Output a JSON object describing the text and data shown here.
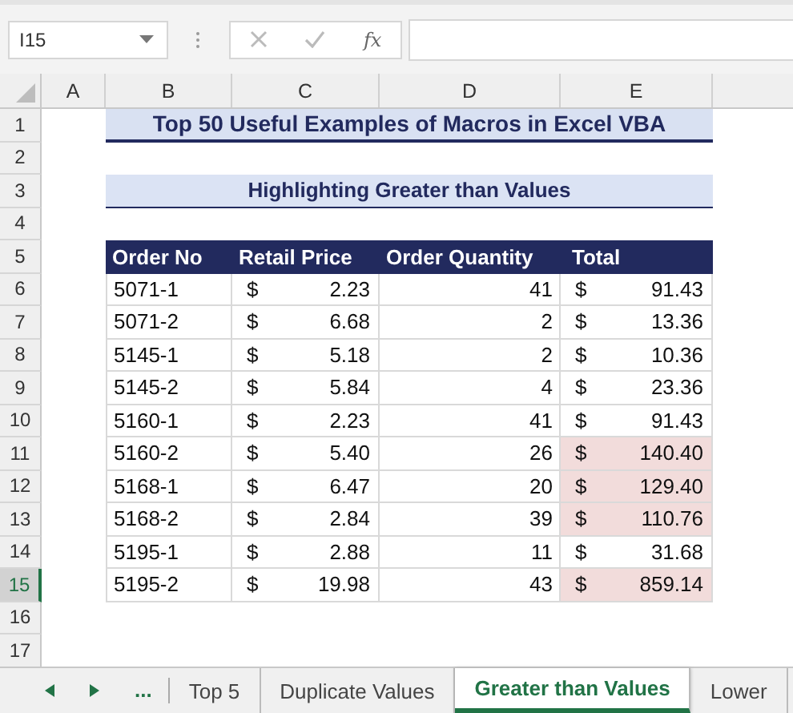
{
  "name_box": "I15",
  "function_label": "fx",
  "column_headers": [
    "A",
    "B",
    "C",
    "D",
    "E"
  ],
  "rows": [
    {
      "number": "1",
      "selected": false,
      "kind": "title",
      "text": "Top 50 Useful Examples of Macros in Excel VBA"
    },
    {
      "number": "2",
      "selected": false,
      "kind": "empty"
    },
    {
      "number": "3",
      "selected": false,
      "kind": "subtitle",
      "text": "Highlighting Greater than Values"
    },
    {
      "number": "4",
      "selected": false,
      "kind": "empty"
    },
    {
      "number": "5",
      "selected": false,
      "kind": "header",
      "cells": [
        "Order No",
        "Retail Price",
        "Order Quantity",
        "Total"
      ]
    },
    {
      "number": "6",
      "selected": false,
      "kind": "data",
      "order_no": "5071-1",
      "price_symbol": "$",
      "price": "2.23",
      "quantity": "41",
      "total_symbol": "$",
      "total": "91.43",
      "highlighted": false
    },
    {
      "number": "7",
      "selected": false,
      "kind": "data",
      "order_no": "5071-2",
      "price_symbol": "$",
      "price": "6.68",
      "quantity": "2",
      "total_symbol": "$",
      "total": "13.36",
      "highlighted": false
    },
    {
      "number": "8",
      "selected": false,
      "kind": "data",
      "order_no": "5145-1",
      "price_symbol": "$",
      "price": "5.18",
      "quantity": "2",
      "total_symbol": "$",
      "total": "10.36",
      "highlighted": false
    },
    {
      "number": "9",
      "selected": false,
      "kind": "data",
      "order_no": "5145-2",
      "price_symbol": "$",
      "price": "5.84",
      "quantity": "4",
      "total_symbol": "$",
      "total": "23.36",
      "highlighted": false
    },
    {
      "number": "10",
      "selected": false,
      "kind": "data",
      "order_no": "5160-1",
      "price_symbol": "$",
      "price": "2.23",
      "quantity": "41",
      "total_symbol": "$",
      "total": "91.43",
      "highlighted": false
    },
    {
      "number": "11",
      "selected": false,
      "kind": "data",
      "order_no": "5160-2",
      "price_symbol": "$",
      "price": "5.40",
      "quantity": "26",
      "total_symbol": "$",
      "total": "140.40",
      "highlighted": true
    },
    {
      "number": "12",
      "selected": false,
      "kind": "data",
      "order_no": "5168-1",
      "price_symbol": "$",
      "price": "6.47",
      "quantity": "20",
      "total_symbol": "$",
      "total": "129.40",
      "highlighted": true
    },
    {
      "number": "13",
      "selected": false,
      "kind": "data",
      "order_no": "5168-2",
      "price_symbol": "$",
      "price": "2.84",
      "quantity": "39",
      "total_symbol": "$",
      "total": "110.76",
      "highlighted": true
    },
    {
      "number": "14",
      "selected": false,
      "kind": "data",
      "order_no": "5195-1",
      "price_symbol": "$",
      "price": "2.88",
      "quantity": "11",
      "total_symbol": "$",
      "total": "31.68",
      "highlighted": false
    },
    {
      "number": "15",
      "selected": true,
      "kind": "data",
      "order_no": "5195-2",
      "price_symbol": "$",
      "price": "19.98",
      "quantity": "43",
      "total_symbol": "$",
      "total": "859.14",
      "highlighted": true
    },
    {
      "number": "16",
      "selected": false,
      "kind": "empty"
    },
    {
      "number": "17",
      "selected": false,
      "kind": "empty"
    }
  ],
  "sheet_overflow": "...",
  "sheet_tabs": [
    {
      "label": "Top 5",
      "selected": false
    },
    {
      "label": "Duplicate Values",
      "selected": false
    },
    {
      "label": "Greater than Values",
      "selected": true
    },
    {
      "label": "Lower",
      "selected": false
    }
  ]
}
